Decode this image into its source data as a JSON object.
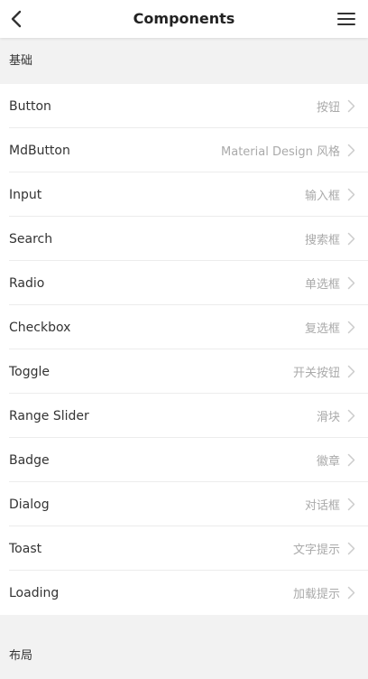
{
  "navbar": {
    "title": "Components",
    "back_icon": "chevron-left-icon",
    "menu_icon": "hamburger-menu-icon"
  },
  "sections": [
    {
      "header": "基础",
      "items": [
        {
          "title": "Button",
          "desc": "按钮"
        },
        {
          "title": "MdButton",
          "desc": "Material Design 风格"
        },
        {
          "title": "Input",
          "desc": "输入框"
        },
        {
          "title": "Search",
          "desc": "搜索框"
        },
        {
          "title": "Radio",
          "desc": "单选框"
        },
        {
          "title": "Checkbox",
          "desc": "复选框"
        },
        {
          "title": "Toggle",
          "desc": "开关按钮"
        },
        {
          "title": "Range Slider",
          "desc": "滑块"
        },
        {
          "title": "Badge",
          "desc": "徽章"
        },
        {
          "title": "Dialog",
          "desc": "对话框"
        },
        {
          "title": "Toast",
          "desc": "文字提示"
        },
        {
          "title": "Loading",
          "desc": "加载提示"
        }
      ]
    },
    {
      "header": "布局",
      "items": []
    }
  ],
  "colors": {
    "background": "#f2f2f2",
    "list_background": "#ffffff",
    "title_text": "#333333",
    "desc_text": "#aaaaaa",
    "chevron": "#cccccc"
  }
}
